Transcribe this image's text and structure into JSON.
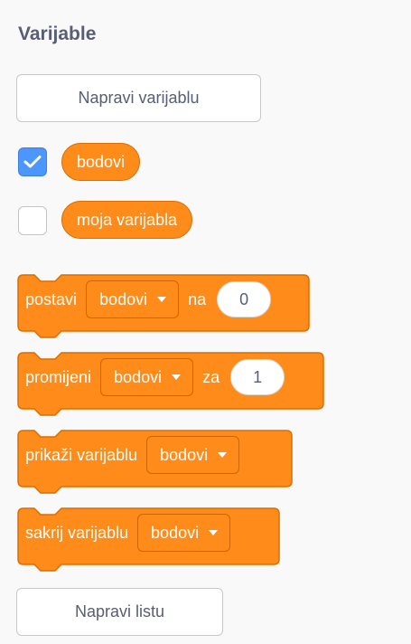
{
  "category": {
    "title": "Varijable"
  },
  "make_variable_label": "Napravi varijablu",
  "make_list_label": "Napravi listu",
  "variables": [
    {
      "name": "bodovi",
      "checked": true
    },
    {
      "name": "moja varijabla",
      "checked": false
    }
  ],
  "blocks": {
    "set": {
      "label": "postavi",
      "dropdown": "bodovi",
      "connector": "na",
      "value": "0"
    },
    "change": {
      "label": "promijeni",
      "dropdown": "bodovi",
      "connector": "za",
      "value": "1"
    },
    "show": {
      "label": "prikaži varijablu",
      "dropdown": "bodovi"
    },
    "hide": {
      "label": "sakrij varijablu",
      "dropdown": "bodovi"
    }
  },
  "colors": {
    "variables_block": "#ff8c1a",
    "block_border": "#db6e00",
    "checkbox_checked": "#4c97ff",
    "heading_text": "#575e75"
  }
}
